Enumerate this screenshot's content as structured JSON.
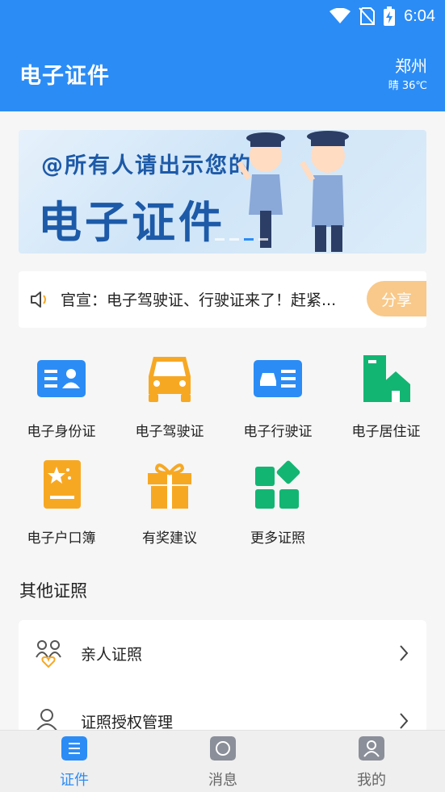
{
  "status_bar": {
    "time": "6:04"
  },
  "app_bar": {
    "title": "电子证件",
    "city": "郑州",
    "weather": "晴 36℃"
  },
  "banner": {
    "line1": "@所有人请出示您的",
    "line2": "电子证件"
  },
  "notice": {
    "text": "官宣：电子驾驶证、行驶证来了！赶紧...",
    "share_label": "分享"
  },
  "grid": [
    {
      "label": "电子身份证",
      "icon": "id-card-icon",
      "color": "#2b8cf6"
    },
    {
      "label": "电子驾驶证",
      "icon": "car-icon",
      "color": "#f7a823"
    },
    {
      "label": "电子行驶证",
      "icon": "vehicle-license-icon",
      "color": "#2b8cf6"
    },
    {
      "label": "电子居住证",
      "icon": "residence-icon",
      "color": "#13b573"
    },
    {
      "label": "电子户口簿",
      "icon": "household-book-icon",
      "color": "#f7a823"
    },
    {
      "label": "有奖建议",
      "icon": "gift-icon",
      "color": "#f7a823"
    },
    {
      "label": "更多证照",
      "icon": "more-apps-icon",
      "color": "#13b573"
    }
  ],
  "other": {
    "title": "其他证照",
    "items": [
      {
        "label": "亲人证照",
        "icon": "family-icon"
      },
      {
        "label": "证照授权管理",
        "icon": "authorize-icon"
      }
    ]
  },
  "bottom_nav": [
    {
      "label": "证件",
      "icon": "certificate-icon",
      "active": true
    },
    {
      "label": "消息",
      "icon": "message-icon",
      "active": false
    },
    {
      "label": "我的",
      "icon": "profile-icon",
      "active": false
    }
  ],
  "colors": {
    "primary": "#2b8cf6",
    "orange": "#f7a823",
    "green": "#13b573",
    "share": "#f8c98a"
  }
}
